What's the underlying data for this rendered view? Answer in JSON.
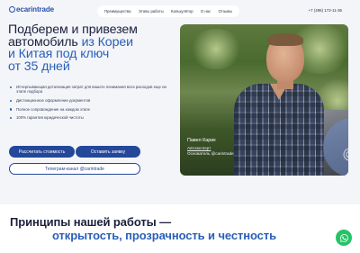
{
  "header": {
    "logo": "ecarintrade",
    "nav": [
      "Преимущества",
      "Этапы работы",
      "Калькулятор",
      "О нас",
      "Отзывы"
    ],
    "phone": "+7 (495) 172-11-36"
  },
  "hero": {
    "headline_line1": "Подберем и привезем",
    "headline_line2_plain": "автомобиль ",
    "headline_line2_accent": "из Кореи",
    "headline_line3_accent": "и Китая под ключ",
    "headline_line4_accent": "от 35 дней",
    "features": [
      "Исчерпывающая детализация затрат для вашего понимания всех расходов еще на этапе подбора",
      "Дистанционное оформление документов",
      "Полное сопровождение на каждом этапе",
      "100% гарантия юридической чистоты"
    ],
    "buttons": {
      "calc": "Рассчитать стоимость",
      "request": "Оставить заявку",
      "telegram": "Телеграм-канал @carintrade"
    },
    "photo_caption": {
      "name": "Павел Карик",
      "role_line1": "Автоэксперт",
      "role_line2": "Основатель @carintrade"
    },
    "badge_text": "@ca"
  },
  "principles": {
    "line1": "Принципы нашей работы —",
    "line2": "открытость, прозрачность и честность"
  },
  "colors": {
    "brand_blue": "#24479a",
    "accent_blue": "#2a5fb8",
    "hero_bg": "#f3f5f9",
    "whatsapp_green": "#25c368"
  }
}
